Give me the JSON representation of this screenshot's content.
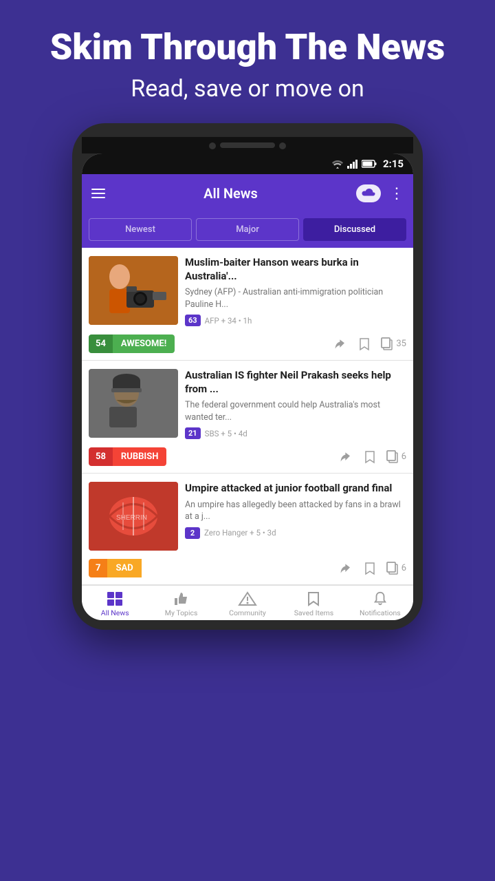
{
  "background": {
    "headline": "Skim Through The News",
    "subheadline": "Read, save or move on"
  },
  "status_bar": {
    "time": "2:15",
    "wifi_icon": "wifi-icon",
    "signal_icon": "signal-icon",
    "battery_icon": "battery-icon"
  },
  "app_bar": {
    "menu_icon": "menu-icon",
    "title": "All News",
    "weather_icon": "weather-icon",
    "more_icon": "more-icon"
  },
  "tabs": [
    {
      "label": "Newest",
      "active": false
    },
    {
      "label": "Major",
      "active": false
    },
    {
      "label": "Discussed",
      "active": true
    }
  ],
  "news_items": [
    {
      "id": 1,
      "title": "Muslim-baiter Hanson wears burka in Australia'...",
      "excerpt": "Sydney (AFP) - Australian anti-immigration politician Pauline H...",
      "badge_count": "63",
      "source": "AFP + 34",
      "time": "1h",
      "vote_count": "54",
      "vote_label": "AWESOME!",
      "vote_type": "awesome",
      "copy_count": "35"
    },
    {
      "id": 2,
      "title": "Australian IS fighter Neil Prakash seeks help from ...",
      "excerpt": "The federal government could help Australia's most wanted ter...",
      "badge_count": "21",
      "source": "SBS + 5",
      "time": "4d",
      "vote_count": "58",
      "vote_label": "RUBBISH",
      "vote_type": "rubbish",
      "copy_count": "6"
    },
    {
      "id": 3,
      "title": "Umpire attacked at junior football grand final",
      "excerpt": "An umpire has allegedly been attacked by fans in a brawl at a j...",
      "badge_count": "2",
      "source": "Zero Hanger + 5",
      "time": "3d",
      "vote_count": "7",
      "vote_label": "SAD",
      "vote_type": "sad",
      "copy_count": "6"
    }
  ],
  "bottom_nav": [
    {
      "label": "All News",
      "icon": "grid-icon",
      "active": true
    },
    {
      "label": "My Topics",
      "icon": "thumbs-up-icon",
      "active": false
    },
    {
      "label": "Community",
      "icon": "community-icon",
      "active": false
    },
    {
      "label": "Saved Items",
      "icon": "bookmark-icon",
      "active": false
    },
    {
      "label": "Notifications",
      "icon": "bell-icon",
      "active": false
    }
  ]
}
